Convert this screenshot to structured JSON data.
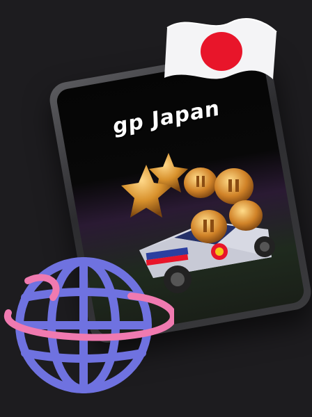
{
  "game": {
    "title": "gp Japan"
  },
  "images": {
    "flag": "japan-flag",
    "stars": "gold-stars",
    "coins": "gold-coins",
    "car": "red-bull-cybertruck",
    "globe": "purple-globe-with-pink-ring"
  },
  "colors": {
    "background": "#1d1c1f",
    "flag_red": "#e8152a",
    "gold": "#d8912c",
    "globe": "#6f72e0",
    "ring": "#f07ab0"
  }
}
